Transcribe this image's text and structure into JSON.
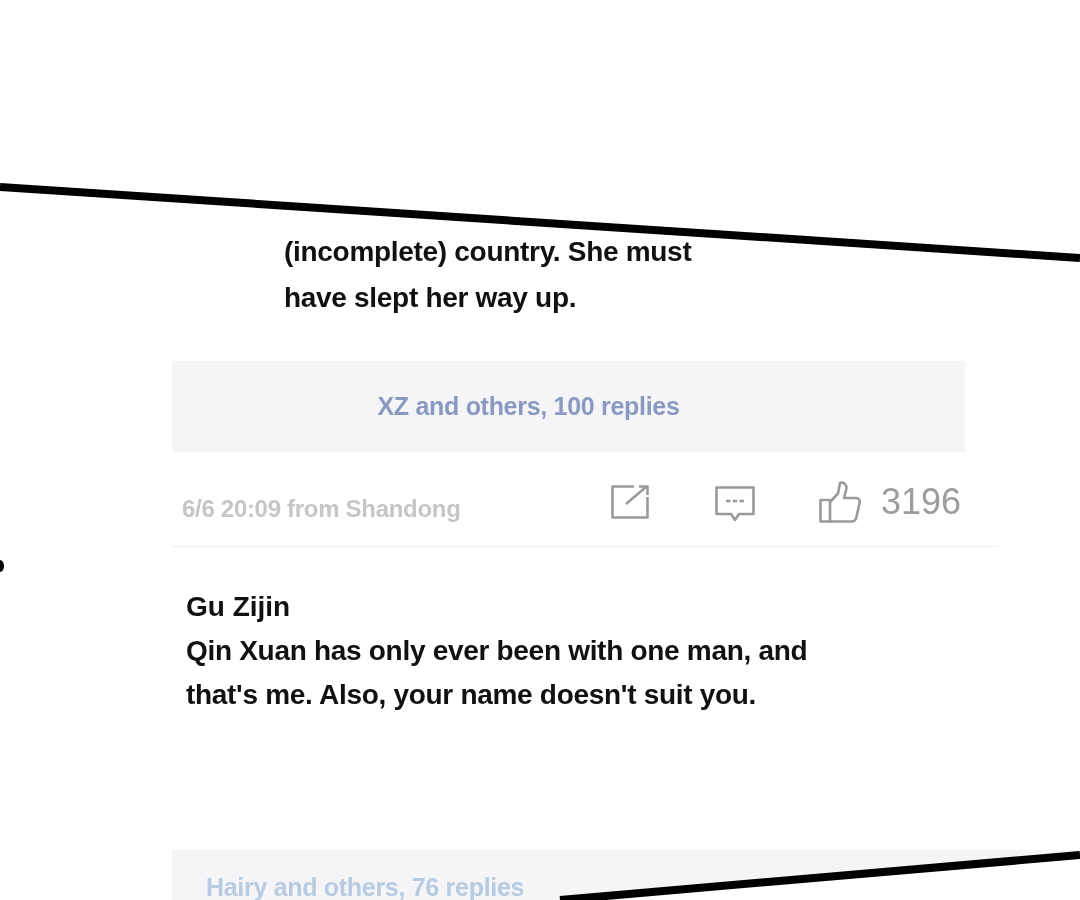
{
  "comments": [
    {
      "text": "(incomplete) country. She must\nhave slept her way up.",
      "replies": {
        "label": "XZ and others, 100 replies",
        "faded": false
      },
      "meta": {
        "time_location": "6/6 20:09 from Shandong",
        "likes": "3196"
      }
    },
    {
      "author": "Gu Zijin",
      "text": "Qin Xuan has only ever been with one man, and\nthat's me. Also, your name doesn't suit you.",
      "replies": {
        "label": "Hairy and others, 76 replies",
        "faded": true
      }
    }
  ]
}
